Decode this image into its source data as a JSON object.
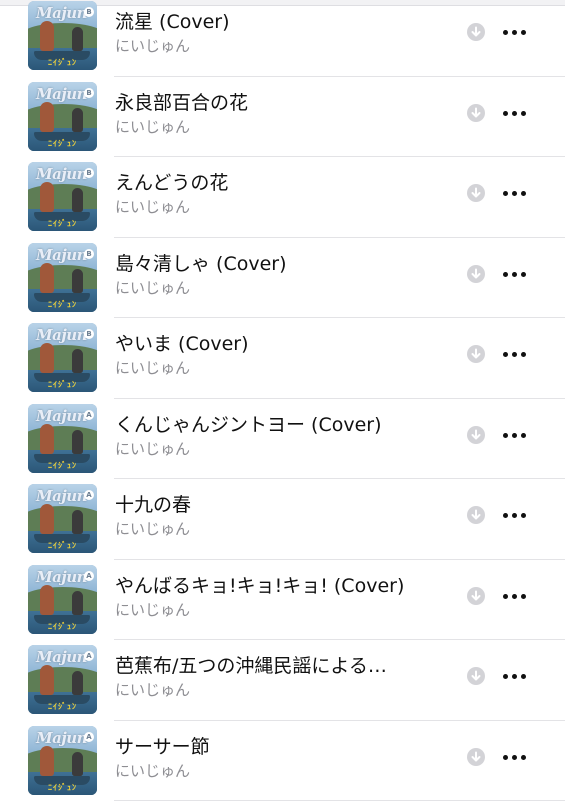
{
  "tracks": [
    {
      "title": "流星 (Cover)",
      "artist": "にいじゅん",
      "disc_badge": "B"
    },
    {
      "title": "永良部百合の花",
      "artist": "にいじゅん",
      "disc_badge": "B"
    },
    {
      "title": "えんどうの花",
      "artist": "にいじゅん",
      "disc_badge": "B"
    },
    {
      "title": "島々清しゃ (Cover)",
      "artist": "にいじゅん",
      "disc_badge": "B"
    },
    {
      "title": "やいま (Cover)",
      "artist": "にいじゅん",
      "disc_badge": "B"
    },
    {
      "title": "くんじゃんジントヨー (Cover)",
      "artist": "にいじゅん",
      "disc_badge": "A"
    },
    {
      "title": "十九の春",
      "artist": "にいじゅん",
      "disc_badge": "A"
    },
    {
      "title": "やんばるキョ!キョ!キョ! (Cover)",
      "artist": "にいじゅん",
      "disc_badge": "A"
    },
    {
      "title": "芭蕉布/五つの沖縄民謡による…",
      "artist": "にいじゅん",
      "disc_badge": "A"
    },
    {
      "title": "サーサー節",
      "artist": "にいじゅん",
      "disc_badge": "A"
    }
  ],
  "artwork": {
    "logo_text": "Majun",
    "sub_text": "ﾆｲｼﾞｭﾝ"
  },
  "icons": {
    "download": "download-circle-icon",
    "more": "more-ellipsis-icon"
  },
  "colors": {
    "title": "#111111",
    "artist": "#8e8e93",
    "download_bg": "#d3d3d7",
    "divider": "#e3e3e6"
  }
}
